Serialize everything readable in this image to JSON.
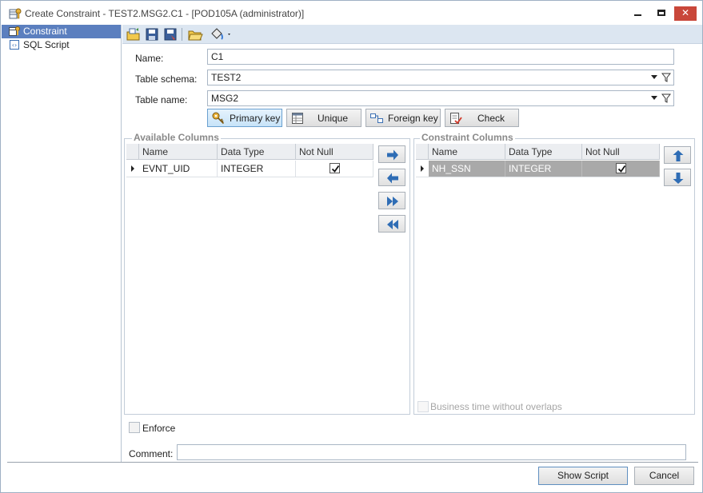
{
  "window": {
    "title": "Create Constraint - TEST2.MSG2.C1 - [POD105A (administrator)]",
    "controls": {
      "close": "✕"
    }
  },
  "sidebar": {
    "items": [
      {
        "label": "Constraint",
        "icon": "constraint-icon",
        "active": true
      },
      {
        "label": "SQL Script",
        "icon": "sql-script-icon",
        "active": false
      }
    ]
  },
  "toolbar": {
    "buttons": [
      "open-folder-icon",
      "save-icon",
      "save-as-icon",
      "browse-folder-icon",
      "paint-bucket-icon"
    ]
  },
  "form": {
    "name_label": "Name:",
    "name_value": "C1",
    "schema_label": "Table schema:",
    "schema_value": "TEST2",
    "table_label": "Table name:",
    "table_value": "MSG2"
  },
  "constraint_types": {
    "primary_key": "Primary key",
    "unique": "Unique",
    "foreign_key": "Foreign key",
    "check": "Check",
    "selected": "Primary key"
  },
  "available": {
    "title": "Available Columns",
    "headers": {
      "name": "Name",
      "type": "Data Type",
      "not_null": "Not Null"
    },
    "rows": [
      {
        "name": "EVNT_UID",
        "type": "INTEGER",
        "not_null": true
      }
    ]
  },
  "constraint_columns": {
    "title": "Constraint Columns",
    "headers": {
      "name": "Name",
      "type": "Data Type",
      "not_null": "Not Null"
    },
    "rows": [
      {
        "name": "NH_SSN",
        "type": "INTEGER",
        "not_null": true
      }
    ],
    "business_time_label": "Business time without overlaps"
  },
  "footer": {
    "enforce_label": "Enforce",
    "comment_label": "Comment:",
    "comment_value": "",
    "show_script_label": "Show Script",
    "cancel_label": "Cancel"
  },
  "colors": {
    "accent": "#5b7fbf",
    "toolbar": "#dce6f1",
    "selected_row": "#a9a9a9",
    "close_button": "#c9473a",
    "arrow_blue": "#2f6db5"
  }
}
